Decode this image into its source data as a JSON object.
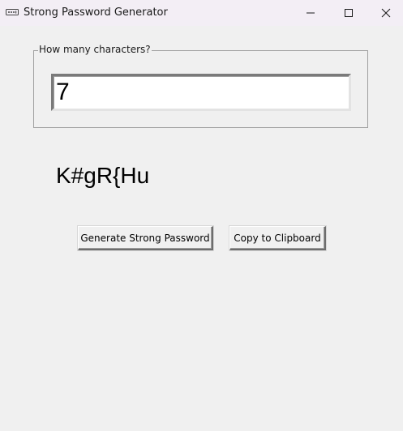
{
  "window": {
    "title": "Strong Password Generator",
    "app_icon": "password-dots-icon",
    "controls": {
      "minimize_icon": "minimize-icon",
      "maximize_icon": "maximize-icon",
      "close_icon": "close-icon"
    }
  },
  "length_group": {
    "label": "How many characters?",
    "value": "7"
  },
  "generated_password": "K#gR{Hu",
  "buttons": {
    "generate_label": "Generate Strong Password",
    "copy_label": "Copy to Clipboard"
  }
}
